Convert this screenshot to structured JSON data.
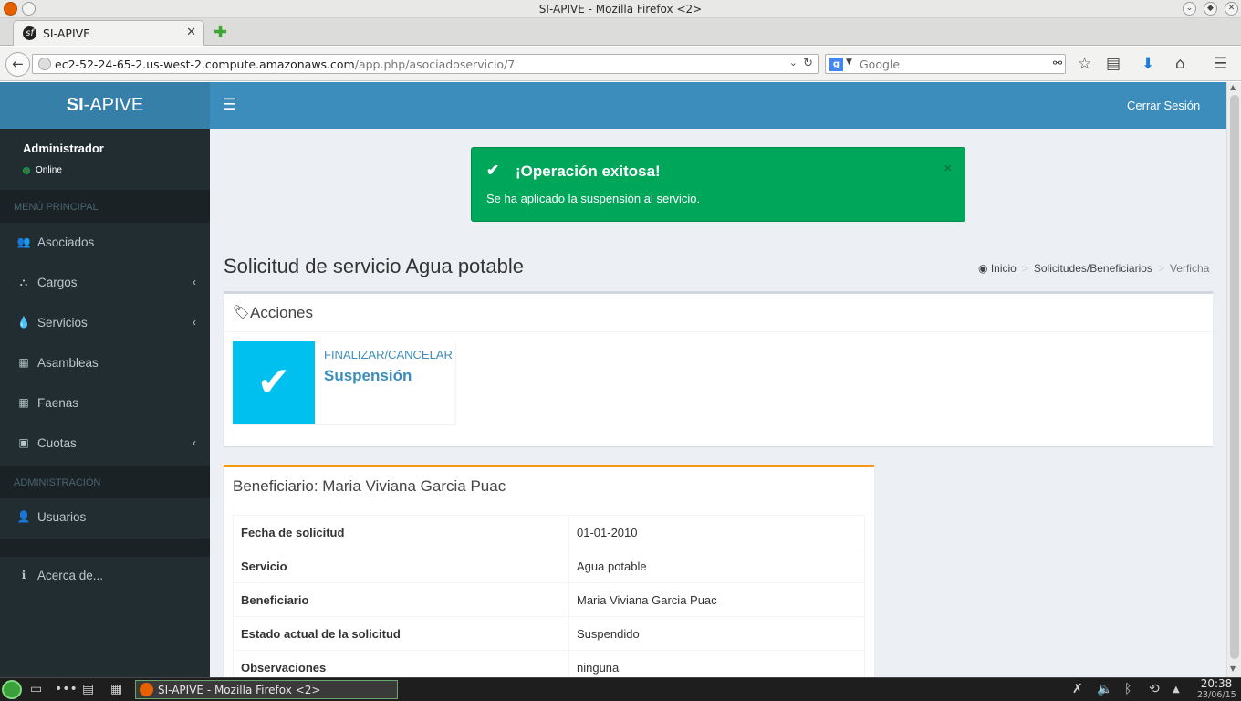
{
  "window": {
    "title": "SI-APIVE - Mozilla Firefox <2>"
  },
  "tab": {
    "label": "SI-APIVE",
    "close": "✕",
    "new": "✚"
  },
  "nav": {
    "url_host": "ec2-52-24-65-2.us-west-2.compute.amazonaws.com",
    "url_path": "/app.php/asociadoservicio/7",
    "search_placeholder": "Google"
  },
  "app": {
    "logo_bold": "SI",
    "logo_rest": "-APIVE",
    "logout": "Cerrar Sesión",
    "user": {
      "name": "Administrador",
      "status": "Online"
    },
    "menu_header": "MENÚ PRINCIPAL",
    "menu": [
      {
        "label": "Asociados",
        "icon": "users-icon"
      },
      {
        "label": "Cargos",
        "icon": "sitemap-icon"
      },
      {
        "label": "Servicios",
        "icon": "drop-icon"
      },
      {
        "label": "Asambleas",
        "icon": "calendar-icon"
      },
      {
        "label": "Faenas",
        "icon": "calendar-icon"
      },
      {
        "label": "Cuotas",
        "icon": "money-icon"
      }
    ],
    "admin_header": "ADMINISTRACIÓN",
    "admin_menu": [
      {
        "label": "Usuarios",
        "icon": "user-icon"
      }
    ],
    "about": {
      "label": "Acerca de...",
      "icon": "info-icon"
    }
  },
  "alert": {
    "title": "¡Operación exitosa!",
    "message": "Se ha aplicado la suspensión al servicio.",
    "close": "×"
  },
  "page": {
    "title": "Solicitud de servicio Agua potable",
    "breadcrumb": {
      "home": "Inicio",
      "section": "Solicitudes/Beneficiarios",
      "current": "Verficha"
    }
  },
  "actions": {
    "title": "Acciones",
    "box": {
      "label": "FINALIZAR/CANCELAR",
      "value": "Suspensión"
    }
  },
  "beneficiary": {
    "title": "Beneficiario: Maria Viviana Garcia Puac",
    "rows": [
      {
        "k": "Fecha de solicitud",
        "v": "01-01-2010"
      },
      {
        "k": "Servicio",
        "v": "Agua potable"
      },
      {
        "k": "Beneficiario",
        "v": "Maria Viviana Garcia Puac"
      },
      {
        "k": "Estado actual de la solicitud",
        "v": "Suspendido"
      },
      {
        "k": "Observaciones",
        "v": "ninguna"
      }
    ]
  },
  "taskbar": {
    "task": "SI-APIVE - Mozilla Firefox <2>",
    "time": "20:38",
    "date": "23/06/15"
  },
  "colors": {
    "header": "#3c8dbc",
    "logo": "#367fa9",
    "sidebar": "#222d32",
    "success": "#00a65a",
    "info": "#00c0ef",
    "warning": "#f39c12"
  }
}
